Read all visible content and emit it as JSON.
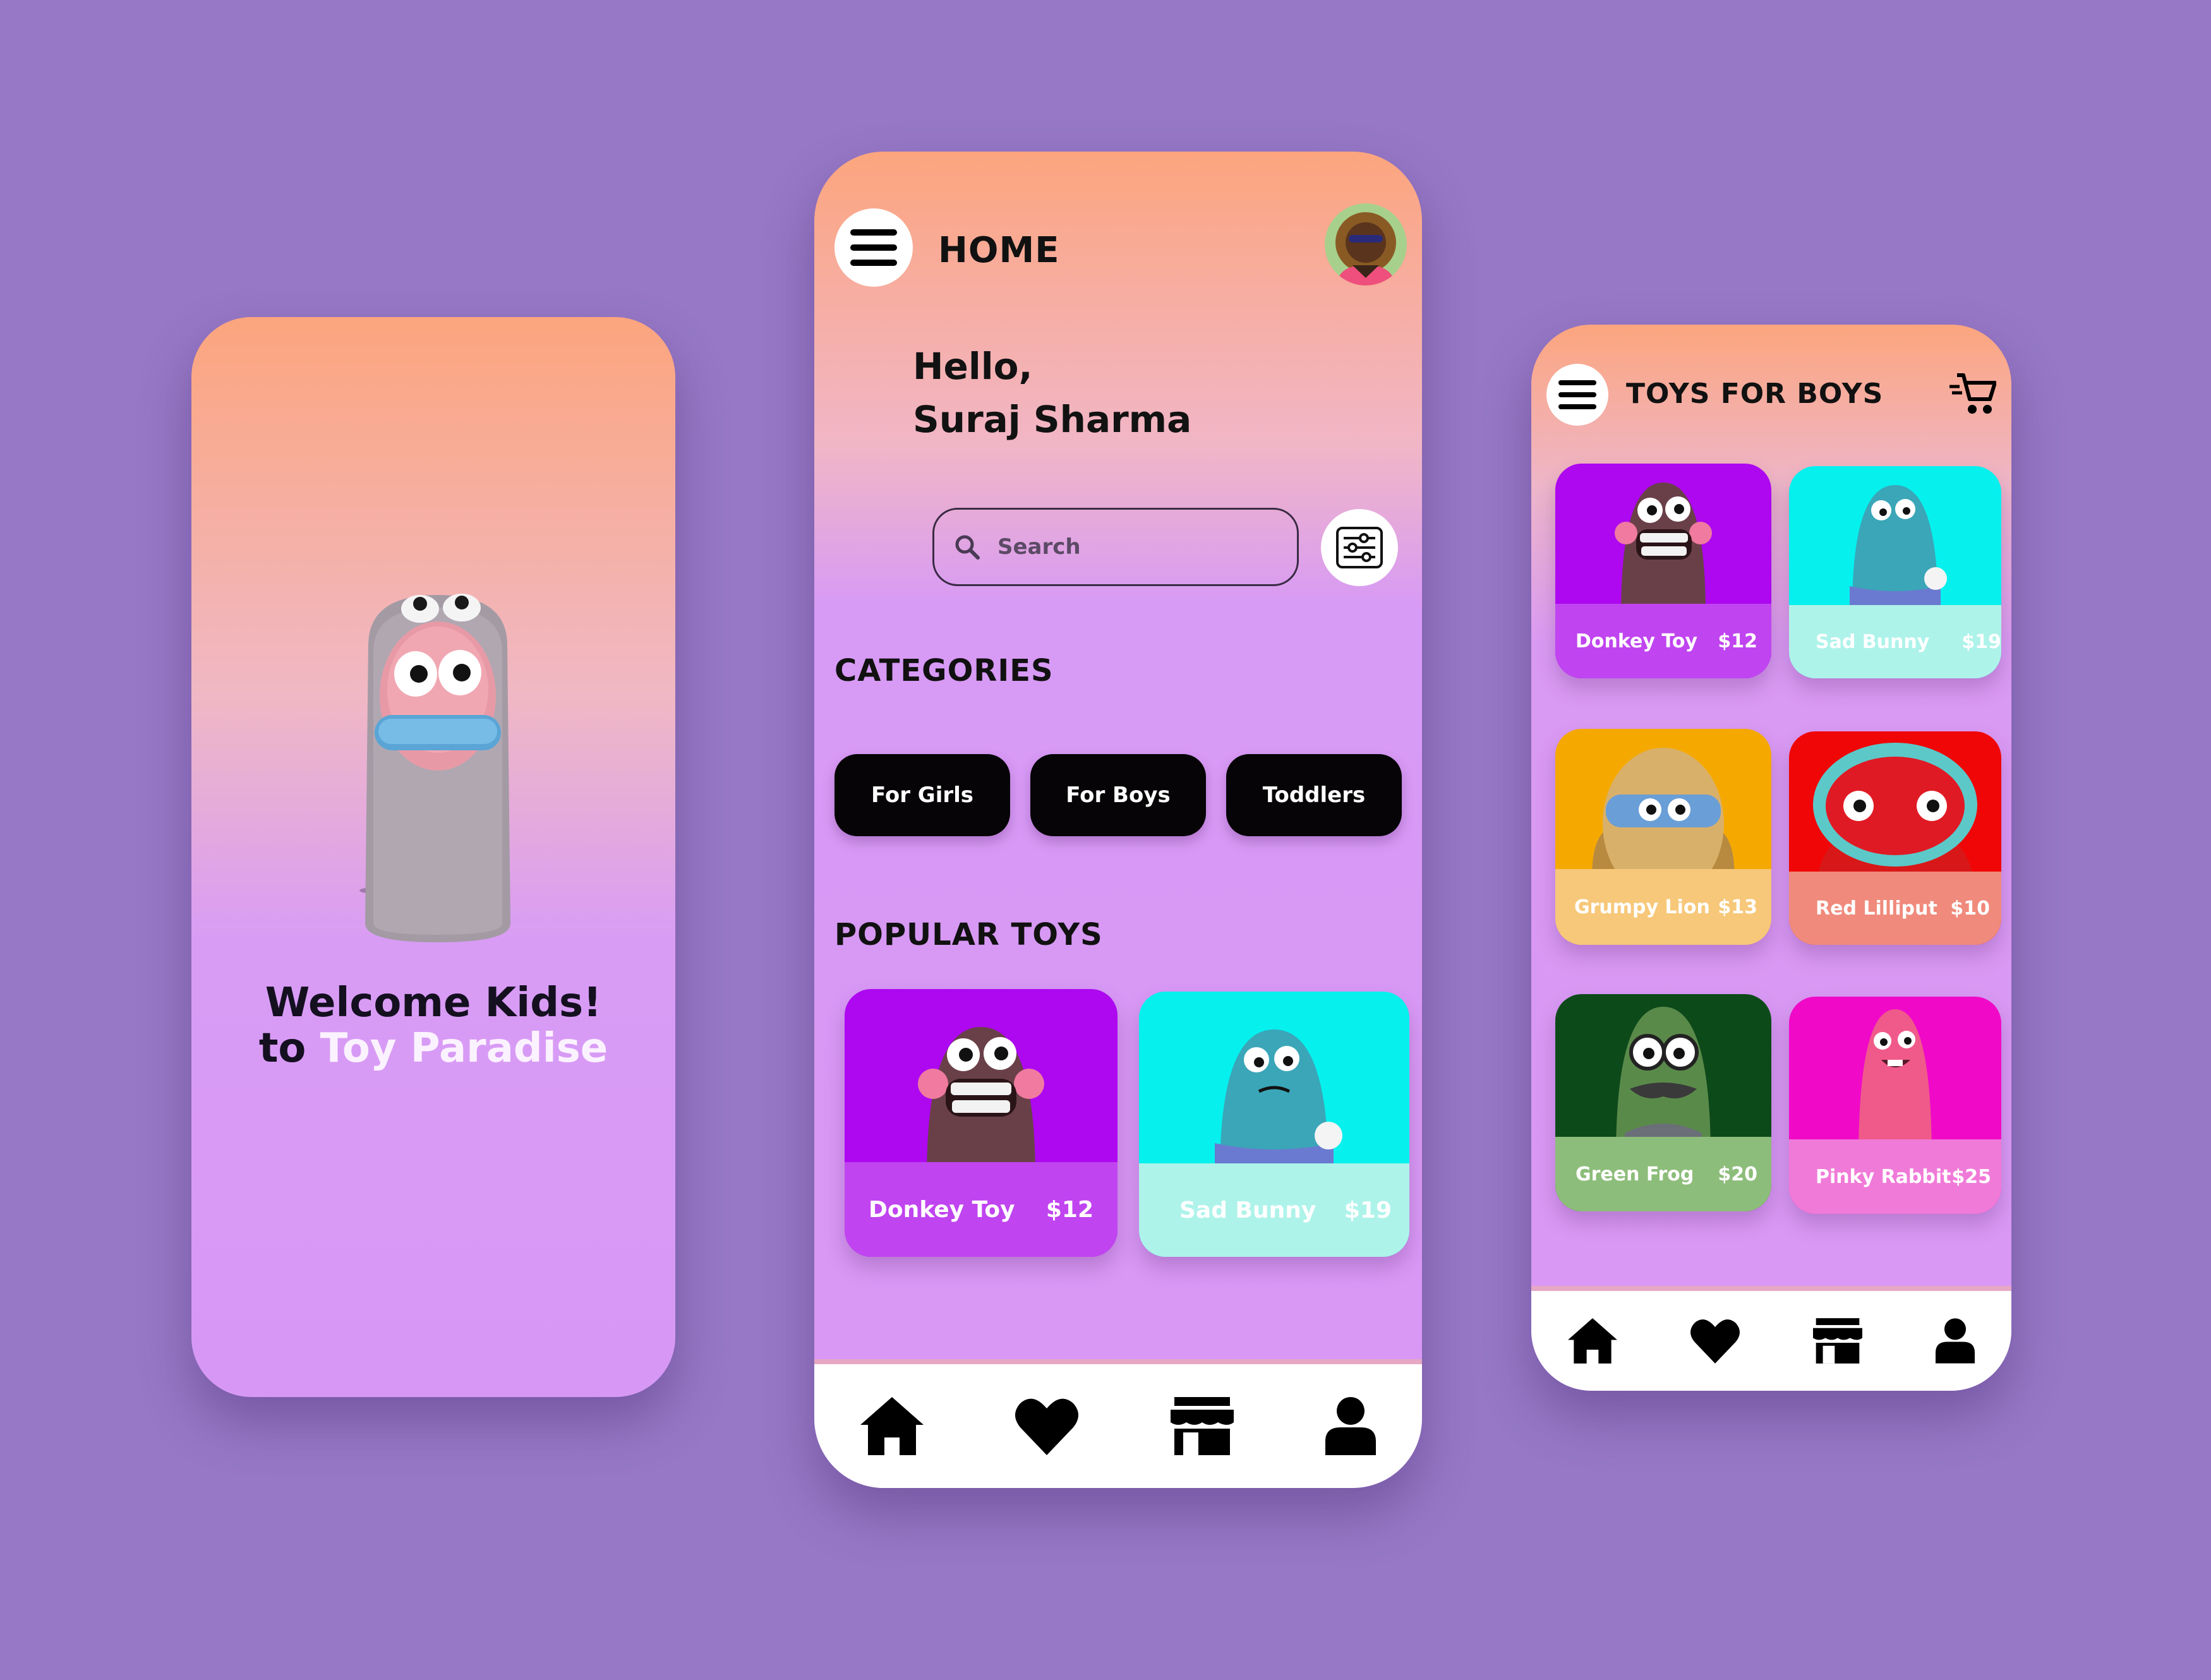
{
  "welcome": {
    "line1": "Welcome Kids!",
    "line2_prefix": "to",
    "line2_accent": "Toy Paradise"
  },
  "home": {
    "title": "HOME",
    "greeting": "Hello,",
    "user_name": "Suraj Sharma",
    "search": {
      "placeholder": "Search"
    },
    "categories_title": "CATEGORIES",
    "categories": [
      {
        "label": "For Girls"
      },
      {
        "label": "For Boys"
      },
      {
        "label": "Toddlers"
      }
    ],
    "popular_title": "POPULAR TOYS",
    "popular": [
      {
        "name": "Donkey Toy",
        "price": "$12",
        "bg": "#ad08f0",
        "label_bg": "#c044f0"
      },
      {
        "name": "Sad Bunny",
        "price": "$19",
        "bg": "#06f0ee",
        "label_bg": "#aef3ea"
      }
    ]
  },
  "boys": {
    "title": "TOYS FOR BOYS",
    "toys": [
      {
        "name": "Donkey Toy",
        "price": "$12",
        "bg": "#ad08f0",
        "label_bg": "#c044f0"
      },
      {
        "name": "Sad Bunny",
        "price": "$19",
        "bg": "#06f0ee",
        "label_bg": "#aef3ea"
      },
      {
        "name": "Grumpy Lion",
        "price": "$13",
        "bg": "#f5a900",
        "label_bg": "#f7c87a"
      },
      {
        "name": "Red Lilliput",
        "price": "$10",
        "bg": "#f00606",
        "label_bg": "#f08a7c"
      },
      {
        "name": "Green Frog",
        "price": "$20",
        "bg": "#0d4a1a",
        "label_bg": "#8dbd7a"
      },
      {
        "name": "Pinky Rabbit",
        "price": "$25",
        "bg": "#f00ac8",
        "label_bg": "#f07ad8"
      }
    ]
  },
  "nav_icons": [
    "home-icon",
    "heart-icon",
    "store-icon",
    "user-icon"
  ]
}
